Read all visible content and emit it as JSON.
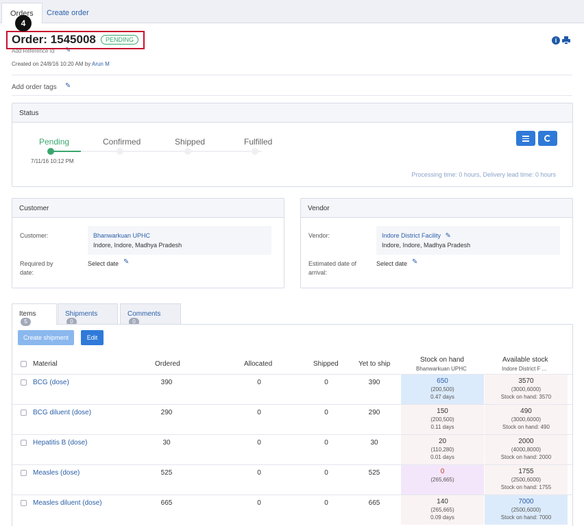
{
  "top_tabs": {
    "orders": "Orders",
    "create_order": "Create order"
  },
  "badge": "4",
  "order": {
    "title": "Order: 1545008",
    "status": "PENDING",
    "add_reference": "Add Reference Id",
    "created_prefix": "Created on 24/8/16 10:20 AM by",
    "created_by": "Arun M",
    "add_tags": "Add order tags"
  },
  "status_panel": {
    "title": "Status",
    "steps": [
      "Pending",
      "Confirmed",
      "Shipped",
      "Fulfilled"
    ],
    "pending_date": "7/11/16 10:12 PM",
    "processing": "Processing time: 0 hours, Delivery lead time: 0 hours"
  },
  "customer": {
    "title": "Customer",
    "label": "Customer:",
    "name": "Bhanwarkuan UPHC",
    "address": "Indore, Indore, Madhya Pradesh",
    "date_label_1": "Required by",
    "date_label_2": "date:",
    "date_value": "Select date"
  },
  "vendor": {
    "title": "Vendor",
    "label": "Vendor:",
    "name": "Indore District Facility",
    "address": "Indore, Indore, Madhya Pradesh",
    "date_label_1": "Estimated date of",
    "date_label_2": "arrival:",
    "date_value": "Select date"
  },
  "item_tabs": {
    "items": "Items",
    "items_count": "5",
    "shipments": "Shipments",
    "shipments_count": "0",
    "comments": "Comments",
    "comments_count": "0"
  },
  "buttons": {
    "create_shipment": "Create shipment",
    "edit": "Edit"
  },
  "table": {
    "headers": {
      "material": "Material",
      "ordered": "Ordered",
      "allocated": "Allocated",
      "shipped": "Shipped",
      "yet_to_ship": "Yet to ship",
      "stock_on_hand": "Stock on hand",
      "stock_on_hand_sub": "Bhanwarkuan UPHC",
      "available_stock": "Available stock",
      "available_stock_sub": "Indore District F ..."
    },
    "rows": [
      {
        "material": "BCG (dose)",
        "ordered": "390",
        "allocated": "0",
        "shipped": "0",
        "yet": "390",
        "soh": "650",
        "soh_range": "(200,500)",
        "soh_days": "0.47 days",
        "soh_color": "#dcebfb",
        "avail": "3570",
        "avail_range": "(3000,6000)",
        "avail_soh": "Stock on hand: 3570",
        "avail_color": "#faf3f3"
      },
      {
        "material": "BCG diluent (dose)",
        "ordered": "290",
        "allocated": "0",
        "shipped": "0",
        "yet": "290",
        "soh": "150",
        "soh_range": "(200,500)",
        "soh_days": "0.11 days",
        "soh_color": "#faf3f3",
        "avail": "490",
        "avail_range": "(3000,6000)",
        "avail_soh": "Stock on hand: 490",
        "avail_color": "#faf3f3"
      },
      {
        "material": "Hepatitis B (dose)",
        "ordered": "30",
        "allocated": "0",
        "shipped": "0",
        "yet": "30",
        "soh": "20",
        "soh_range": "(110,280)",
        "soh_days": "0.01 days",
        "soh_color": "#faf3f3",
        "avail": "2000",
        "avail_range": "(4000,8000)",
        "avail_soh": "Stock on hand: 2000",
        "avail_color": "#faf3f3"
      },
      {
        "material": "Measles (dose)",
        "ordered": "525",
        "allocated": "0",
        "shipped": "0",
        "yet": "525",
        "soh": "0",
        "soh_range": "(265,665)",
        "soh_days": "",
        "soh_color": "#f3e6fa",
        "avail": "1755",
        "avail_range": "(2500,6000)",
        "avail_soh": "Stock on hand: 1755",
        "avail_color": "#faf3f3"
      },
      {
        "material": "Measles diluent (dose)",
        "ordered": "665",
        "allocated": "0",
        "shipped": "0",
        "yet": "665",
        "soh": "140",
        "soh_range": "(265,665)",
        "soh_days": "0.09 days",
        "soh_color": "#faf3f3",
        "avail": "7000",
        "avail_range": "(2500,6000)",
        "avail_soh": "Stock on hand: 7000",
        "avail_color": "#dcebfb"
      }
    ]
  }
}
